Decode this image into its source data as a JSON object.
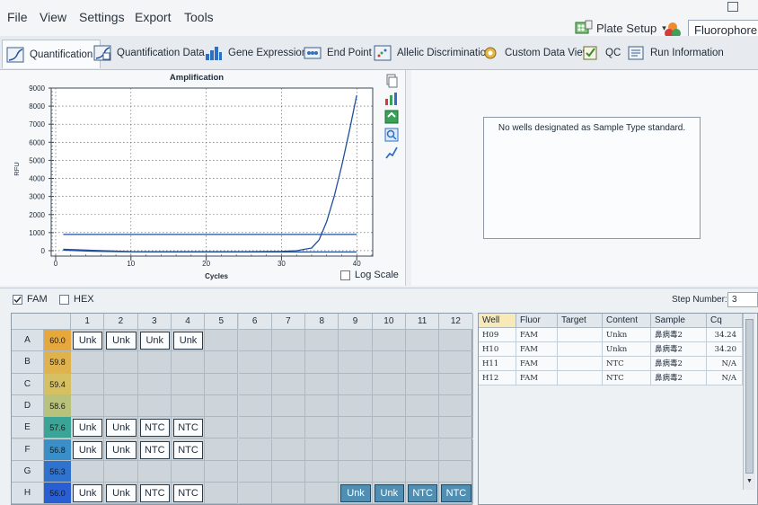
{
  "menu": [
    "File",
    "View",
    "Settings",
    "Export",
    "Tools"
  ],
  "toolbar": {
    "plate_setup": "Plate Setup",
    "fluorophore": "Fluorophore"
  },
  "tabs": [
    "Quantification",
    "Quantification Data",
    "Gene Expression",
    "End Point",
    "Allelic Discrimination",
    "Custom Data View",
    "QC",
    "Run Information"
  ],
  "chart": {
    "title": "Amplification",
    "ylabel": "RFU",
    "xlabel": "Cycles",
    "log_scale_label": "Log Scale",
    "log_scale_checked": false
  },
  "chart_data": {
    "type": "line",
    "title": "Amplification",
    "xlabel": "Cycles",
    "ylabel": "RFU",
    "xlim": [
      0,
      42
    ],
    "ylim": [
      -300,
      9000
    ],
    "x_ticks": [
      0,
      10,
      20,
      30,
      40
    ],
    "y_ticks": [
      0,
      1000,
      2000,
      3000,
      4000,
      5000,
      6000,
      7000,
      8000,
      9000
    ],
    "grid": true,
    "threshold": 900,
    "series": [
      {
        "x": [
          1,
          5,
          10,
          15,
          20,
          25,
          30,
          32,
          34,
          35,
          36,
          37,
          38,
          39,
          40
        ],
        "values": [
          80,
          20,
          -50,
          -60,
          -60,
          -55,
          -40,
          0,
          150,
          600,
          1600,
          3000,
          4700,
          6600,
          8600
        ]
      },
      {
        "x": [
          1,
          5,
          10,
          15,
          20,
          25,
          30,
          35,
          40
        ],
        "values": [
          30,
          -30,
          -60,
          -70,
          -70,
          -70,
          -70,
          -70,
          -70
        ]
      }
    ]
  },
  "standard_curve": {
    "message": "No wells designated as Sample Type standard."
  },
  "filters": {
    "fam": "FAM",
    "fam_checked": true,
    "hex": "HEX",
    "hex_checked": false,
    "step_label": "Step Number:",
    "step_value": "3"
  },
  "plate": {
    "columns": [
      "1",
      "2",
      "3",
      "4",
      "5",
      "6",
      "7",
      "8",
      "9",
      "10",
      "11",
      "12"
    ],
    "rows": [
      {
        "label": "A",
        "temp": "60.0",
        "temp_color": "#e6a73c",
        "wells": [
          "Unk",
          "Unk",
          "Unk",
          "Unk",
          "",
          "",
          "",
          "",
          "",
          "",
          "",
          ""
        ]
      },
      {
        "label": "B",
        "temp": "59.8",
        "temp_color": "#dfb24e",
        "wells": [
          "",
          "",
          "",
          "",
          "",
          "",
          "",
          "",
          "",
          "",
          "",
          ""
        ]
      },
      {
        "label": "C",
        "temp": "59.4",
        "temp_color": "#d7c062",
        "wells": [
          "",
          "",
          "",
          "",
          "",
          "",
          "",
          "",
          "",
          "",
          "",
          ""
        ]
      },
      {
        "label": "D",
        "temp": "58.6",
        "temp_color": "#b9c27a",
        "wells": [
          "",
          "",
          "",
          "",
          "",
          "",
          "",
          "",
          "",
          "",
          "",
          ""
        ]
      },
      {
        "label": "E",
        "temp": "57.6",
        "temp_color": "#3aa597",
        "wells": [
          "Unk",
          "Unk",
          "NTC",
          "NTC",
          "",
          "",
          "",
          "",
          "",
          "",
          "",
          ""
        ]
      },
      {
        "label": "F",
        "temp": "56.8",
        "temp_color": "#3b8fc8",
        "wells": [
          "Unk",
          "Unk",
          "NTC",
          "NTC",
          "",
          "",
          "",
          "",
          "",
          "",
          "",
          ""
        ]
      },
      {
        "label": "G",
        "temp": "56.3",
        "temp_color": "#3073cf",
        "wells": [
          "",
          "",
          "",
          "",
          "",
          "",
          "",
          "",
          "",
          "",
          "",
          ""
        ]
      },
      {
        "label": "H",
        "temp": "56.0",
        "temp_color": "#2a5fd4",
        "wells": [
          "Unk",
          "Unk",
          "NTC",
          "NTC",
          "",
          "",
          "",
          "",
          "Unk",
          "Unk",
          "NTC",
          "NTC"
        ],
        "selected_from": 8
      }
    ]
  },
  "results": {
    "headers": [
      "Well",
      "Fluor",
      "Target",
      "Content",
      "Sample",
      "Cq"
    ],
    "rows": [
      [
        "H09",
        "FAM",
        "",
        "Unkn",
        "鼻病毒2",
        "34.24"
      ],
      [
        "H10",
        "FAM",
        "",
        "Unkn",
        "鼻病毒2",
        "34.20"
      ],
      [
        "H11",
        "FAM",
        "",
        "NTC",
        "鼻病毒2",
        "N/A"
      ],
      [
        "H12",
        "FAM",
        "",
        "NTC",
        "鼻病毒2",
        "N/A"
      ]
    ]
  },
  "colors": {
    "curve": "#1f4f9c",
    "threshold": "#1f4f9c",
    "accent": "#4f8fb3"
  }
}
